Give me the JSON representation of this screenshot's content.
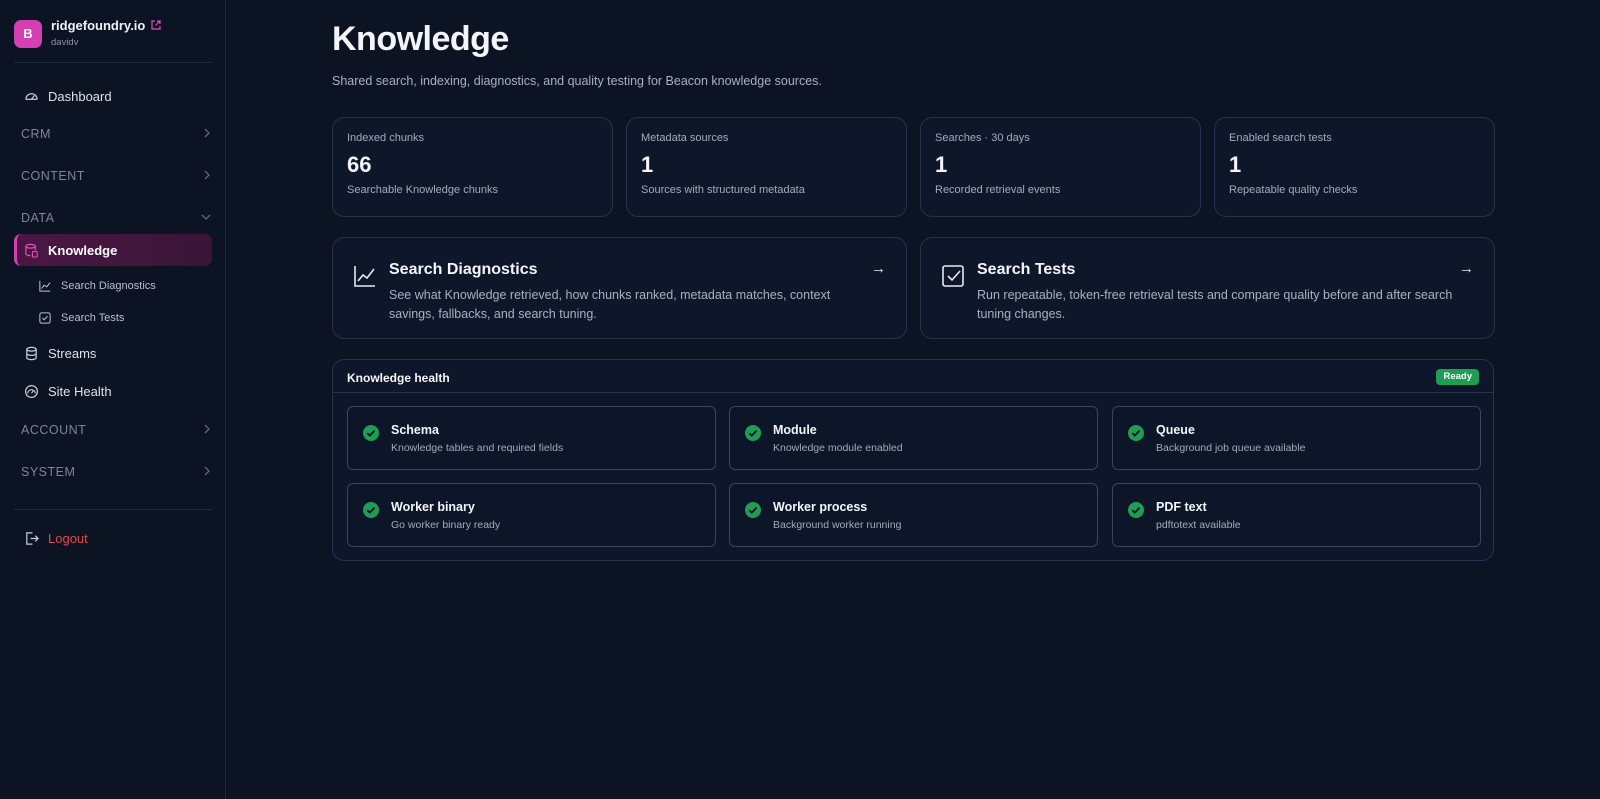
{
  "brand": {
    "avatar_letter": "B",
    "name": "ridgefoundry.io",
    "user": "davidv",
    "avatar_color": "#d63fb3"
  },
  "sidebar": {
    "dashboard": {
      "label": "Dashboard",
      "icon": "gauge-icon"
    },
    "sections": {
      "crm": "CRM",
      "content": "CONTENT",
      "data": "DATA",
      "account": "ACCOUNT",
      "system": "SYSTEM"
    },
    "knowledge": {
      "label": "Knowledge",
      "icon": "database-file-icon"
    },
    "search_diagnostics": {
      "label": "Search Diagnostics",
      "icon": "line-chart-icon"
    },
    "search_tests": {
      "label": "Search Tests",
      "icon": "check-square-icon"
    },
    "streams": {
      "label": "Streams",
      "icon": "database-icon"
    },
    "site_health": {
      "label": "Site Health",
      "icon": "gauge-circle-icon"
    },
    "logout": {
      "label": "Logout",
      "icon": "logout-icon"
    }
  },
  "page": {
    "title": "Knowledge",
    "subtitle": "Shared search, indexing, diagnostics, and quality testing for Beacon knowledge sources."
  },
  "stats": [
    {
      "label": "Indexed chunks",
      "value": "66",
      "desc": "Searchable Knowledge chunks"
    },
    {
      "label": "Metadata sources",
      "value": "1",
      "desc": "Sources with structured metadata"
    },
    {
      "label": "Searches · 30 days",
      "value": "1",
      "desc": "Recorded retrieval events"
    },
    {
      "label": "Enabled search tests",
      "value": "1",
      "desc": "Repeatable quality checks"
    }
  ],
  "links": [
    {
      "title": "Search Diagnostics",
      "desc": "See what Knowledge retrieved, how chunks ranked, metadata matches, context savings, fallbacks, and search tuning.",
      "arrow": "→",
      "icon": "line-chart-icon"
    },
    {
      "title": "Search Tests",
      "desc": "Run repeatable, token-free retrieval tests and compare quality before and after search tuning changes.",
      "arrow": "→",
      "icon": "check-square-icon"
    }
  ],
  "health": {
    "title": "Knowledge health",
    "badge": "Ready",
    "badge_color": "#1f9d55",
    "checks": [
      {
        "title": "Schema",
        "desc": "Knowledge tables and required fields"
      },
      {
        "title": "Module",
        "desc": "Knowledge module enabled"
      },
      {
        "title": "Queue",
        "desc": "Background job queue available"
      },
      {
        "title": "Worker binary",
        "desc": "Go worker binary ready"
      },
      {
        "title": "Worker process",
        "desc": "Background worker running"
      },
      {
        "title": "PDF text",
        "desc": "pdftotext available"
      }
    ]
  },
  "colors": {
    "accent": "#d63fb3",
    "success": "#1f9d55",
    "danger": "#e5484d",
    "background": "#0c1424"
  }
}
